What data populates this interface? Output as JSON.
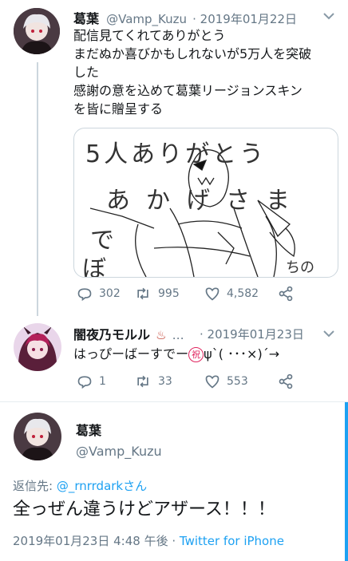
{
  "tweet1": {
    "name": "葛葉",
    "handle": "@Vamp_Kuzu",
    "date": "· 2019年01月22日",
    "lines": [
      "配信見てくれてありがとう",
      "まだぬか喜びかもしれないが5万人を突破",
      "した",
      "感謝の意を込めて葛葉リージョンスキン",
      "を皆に贈呈する"
    ],
    "drawing": {
      "row1": "5人ありがとう",
      "row2": "あかげさま",
      "row3": "で",
      "row4": "ぼ",
      "row5": "ちの"
    },
    "replies": "302",
    "retweets": "995",
    "likes": "4,582"
  },
  "tweet2": {
    "name": "闇夜乃モルル",
    "emoji": "♨",
    "dots": "…",
    "date": "· 2019年01月23日",
    "text_before": "はっぴーばーすでー",
    "badge": "祝",
    "text_after": "ψ`( ･･･×)´→",
    "replies": "1",
    "retweets": "33",
    "likes": "553"
  },
  "tweet3": {
    "name": "葛葉",
    "handle": "@Vamp_Kuzu",
    "reply_label": "返信先: ",
    "reply_handle": "@_rnrrdarkさん",
    "text": "全っぜん違うけどアザース！！！",
    "date": "2019年01月23日 4:48 午後",
    "dot": " · ",
    "client": "Twitter for iPhone"
  },
  "colors": {
    "accent": "#1da1f2",
    "muted": "#657786",
    "line": "#ccd6dd",
    "badge": "#e0245e"
  },
  "icons": [
    "reply-icon",
    "retweet-icon",
    "like-icon",
    "share-icon",
    "chevron-down-icon"
  ]
}
